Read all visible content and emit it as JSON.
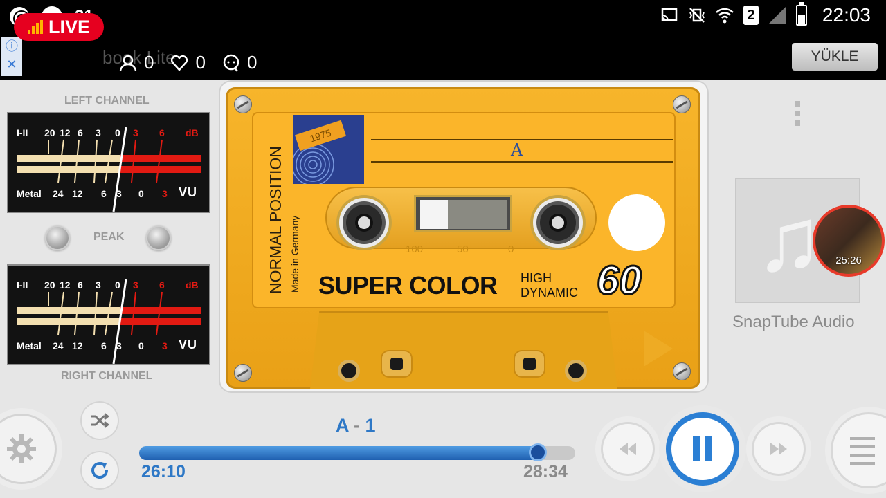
{
  "status_bar": {
    "notification_live": "LIVE",
    "notification_count": "31",
    "sim_slot": "2",
    "time": "22:03"
  },
  "app_bar": {
    "live_label": "LIVE",
    "ghost_text": "book Lite",
    "viewers": "0",
    "likes": "0",
    "comments": "0",
    "upload_button": "YÜKLE"
  },
  "vu_meters": {
    "left_label": "LEFT CHANNEL",
    "right_label": "RIGHT CHANNEL",
    "peak_label": "PEAK",
    "scale_top": [
      "I-II",
      "20",
      "12",
      "6",
      "3",
      "0",
      "3",
      "6",
      "dB"
    ],
    "scale_bottom": [
      "Metal",
      "24",
      "12",
      "6",
      "3",
      "0",
      "3"
    ],
    "unit": "VU"
  },
  "cassette": {
    "sticker_year": "1975",
    "side": "A",
    "position": "NORMAL POSITION",
    "made_in": "Made in Germany",
    "brand": "SUPER COLOR",
    "brand_sub_1": "HIGH",
    "brand_sub_2": "DYNAMIC",
    "length": "60",
    "counter_scale": [
      "100",
      "50",
      "0"
    ]
  },
  "now_playing": {
    "album_title": "SnapTube Audio",
    "bubble_time": "25:26",
    "track_side": "A",
    "track_sep": " - ",
    "track_num": "1",
    "current_time": "26:10",
    "total_time": "28:34",
    "progress": 0.915
  },
  "colors": {
    "accent": "#2e78c6",
    "live_red": "#e6001f",
    "cassette_yellow": "#f7b52b"
  }
}
